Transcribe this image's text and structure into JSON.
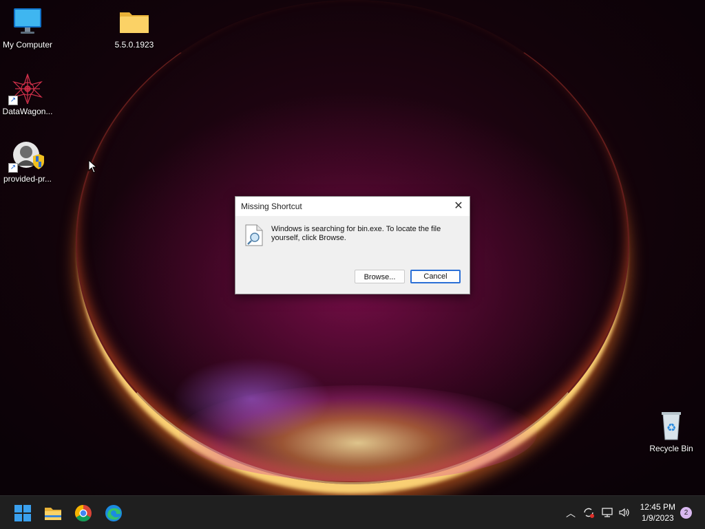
{
  "desktop": {
    "icons": [
      {
        "label": "My Computer",
        "icon": "monitor-icon"
      },
      {
        "label": "5.5.0.1923",
        "icon": "folder-icon"
      },
      {
        "label": "DataWagon...",
        "icon": "datawagon-icon"
      },
      {
        "label": "provided-pr...",
        "icon": "user-shield-icon"
      },
      {
        "label": "Recycle Bin",
        "icon": "recycle-bin-icon"
      }
    ]
  },
  "dialog": {
    "title": "Missing Shortcut",
    "message": "Windows is searching for bin.exe. To locate the file yourself, click Browse.",
    "browse_label": "Browse...",
    "cancel_label": "Cancel"
  },
  "taskbar": {
    "apps": [
      "start-icon",
      "file-explorer-icon",
      "chrome-icon",
      "edge-icon"
    ],
    "clock_time": "12:45 PM",
    "clock_date": "1/9/2023",
    "notification_count": "2"
  },
  "colors": {
    "taskbar_bg": "#1f1f1f",
    "dialog_default_border": "#2a6fd6"
  }
}
